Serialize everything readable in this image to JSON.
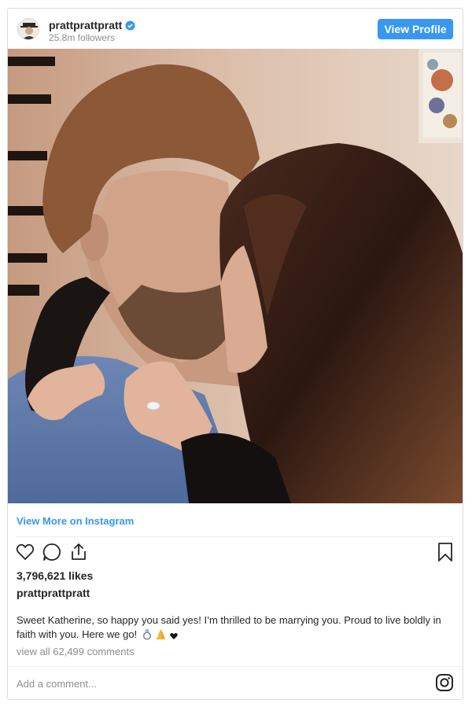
{
  "post": {
    "username": "pratt​prattpratt",
    "followers": "25.8m followers",
    "view_profile_label": "View Profile",
    "view_more_label": "View More on Instagram",
    "likes": "3,796,621 likes",
    "caption_user": "prattprattpratt",
    "caption_text": "Sweet Katherine, so happy you said yes! I’m thrilled to be marrying you. Proud to live boldly in faith with you. Here we go!",
    "view_comments": "view all 62,499 comments",
    "add_comment_placeholder": "Add a comment..."
  },
  "icons": {
    "verified": "verified-badge-icon",
    "like": "heart-icon",
    "comment": "comment-icon",
    "share": "share-icon",
    "save": "bookmark-icon",
    "instagram": "instagram-glyph-icon",
    "caption_emojis": [
      "ring-emoji",
      "praying-hands-emoji",
      "black-heart-emoji"
    ]
  },
  "colors": {
    "accent": "#3897f0",
    "text": "#262626",
    "muted": "#8e8e8e",
    "border": "#dbdbdb"
  }
}
